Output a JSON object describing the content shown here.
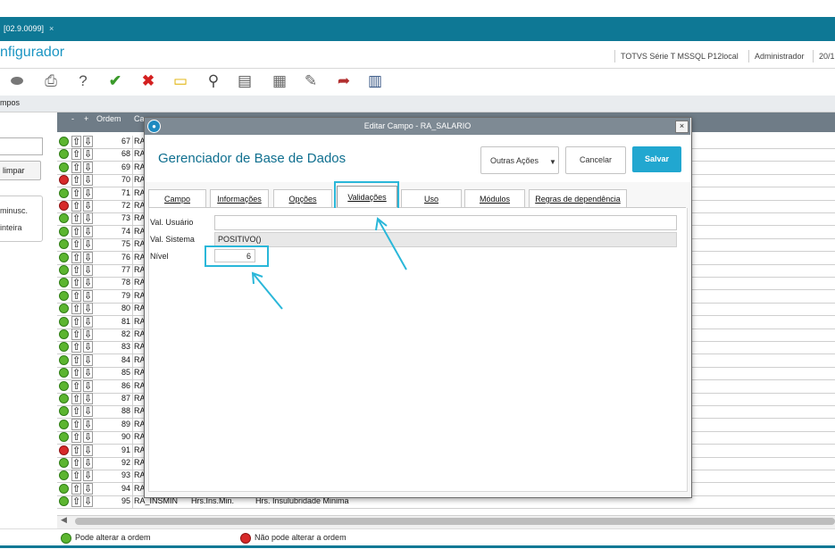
{
  "app": {
    "tab_label": "[02.9.0099]",
    "tab_close": "×",
    "title": "nfigurador",
    "status": {
      "system": "TOTVS Série T  MSSQL P12local",
      "user": "Administrador",
      "date": "20/1"
    }
  },
  "toolbar": {
    "icons": [
      "eraser-icon",
      "printer-icon",
      "help-icon",
      "confirm-check-icon",
      "delete-x-icon",
      "folder-icon",
      "search-icon",
      "preview-icon",
      "add-document-icon",
      "edit-document-icon",
      "export-document-icon",
      "calendar-icon"
    ]
  },
  "subbar": {
    "label": "mpos"
  },
  "left_panel": {
    "clear_button": "limpar",
    "options": [
      "minusc.",
      "inteira"
    ]
  },
  "grid": {
    "headers": {
      "minus": "-",
      "plus": "+",
      "order": "Ordem",
      "field": "Ca"
    },
    "rows": [
      {
        "order": "67",
        "field": "RA",
        "status": "green"
      },
      {
        "order": "68",
        "field": "RA",
        "status": "green"
      },
      {
        "order": "69",
        "field": "RA",
        "status": "green"
      },
      {
        "order": "70",
        "field": "RA",
        "status": "red"
      },
      {
        "order": "71",
        "field": "RA",
        "status": "green"
      },
      {
        "order": "72",
        "field": "RA",
        "status": "red"
      },
      {
        "order": "73",
        "field": "RA",
        "status": "green"
      },
      {
        "order": "74",
        "field": "RA",
        "status": "green"
      },
      {
        "order": "75",
        "field": "RA",
        "status": "green"
      },
      {
        "order": "76",
        "field": "RA",
        "status": "green"
      },
      {
        "order": "77",
        "field": "RA",
        "status": "green"
      },
      {
        "order": "78",
        "field": "RA",
        "status": "green"
      },
      {
        "order": "79",
        "field": "RA",
        "status": "green"
      },
      {
        "order": "80",
        "field": "RA",
        "status": "green"
      },
      {
        "order": "81",
        "field": "RA",
        "status": "green"
      },
      {
        "order": "82",
        "field": "RA",
        "status": "green"
      },
      {
        "order": "83",
        "field": "RA",
        "status": "green"
      },
      {
        "order": "84",
        "field": "RA",
        "status": "green"
      },
      {
        "order": "85",
        "field": "RA",
        "status": "green"
      },
      {
        "order": "86",
        "field": "RA",
        "status": "green"
      },
      {
        "order": "87",
        "field": "RA",
        "status": "green"
      },
      {
        "order": "88",
        "field": "RA",
        "status": "green"
      },
      {
        "order": "89",
        "field": "RA",
        "status": "green"
      },
      {
        "order": "90",
        "field": "RA",
        "status": "green"
      },
      {
        "order": "91",
        "field": "RA",
        "status": "red"
      },
      {
        "order": "92",
        "field": "RA",
        "status": "green"
      },
      {
        "order": "93",
        "field": "RA",
        "status": "green"
      },
      {
        "order": "94",
        "field": "RA",
        "status": "green"
      },
      {
        "order": "95",
        "field": "RA_INSMIN",
        "status": "green",
        "title": "Hrs.Ins.Min.",
        "description": "Hrs. Insulubridade Minima"
      }
    ]
  },
  "legend": {
    "can_change": "Pode alterar a ordem",
    "cannot_change": "Não pode alterar a ordem"
  },
  "dialog": {
    "title": "Editar Campo - RA_SALARIO",
    "close": "×",
    "heading": "Gerenciador de Base de Dados",
    "buttons": {
      "more_actions": "Outras Ações",
      "cancel": "Cancelar",
      "save": "Salvar"
    },
    "tabs": [
      "Campo",
      "Informações",
      "Opções",
      "Validações",
      "Uso",
      "Módulos",
      "Regras de dependência"
    ],
    "active_tab": "Validações",
    "fields": {
      "user_validation_label": "Val. Usuário",
      "user_validation_value": "",
      "system_validation_label": "Val. Sistema",
      "system_validation_value": "POSITIVO()",
      "level_label": "Nível",
      "level_value": "6"
    }
  },
  "colors": {
    "accent": "#0e7895",
    "highlight": "#2ab7d9",
    "save": "#21a7d0",
    "grid_header": "#6f7c87"
  }
}
